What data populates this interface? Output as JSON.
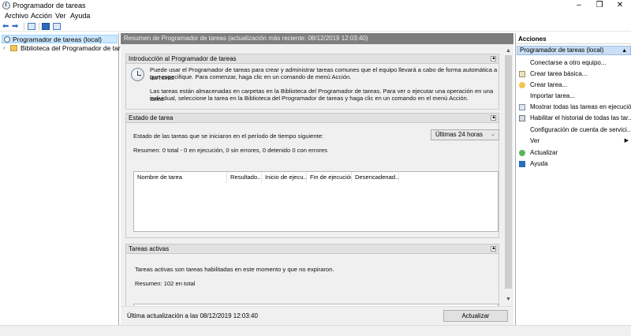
{
  "window": {
    "title": "Programador de tareas",
    "minimize": "–",
    "restore": "❐",
    "close": "✕"
  },
  "menu": [
    "Archivo",
    "Acción",
    "Ver",
    "Ayuda"
  ],
  "toolbar": {
    "back_icon": "arrow-left-icon",
    "forward_icon": "arrow-right-icon",
    "back": "⬅",
    "forward": "➡"
  },
  "tree": {
    "root": "Programador de tareas (local)",
    "child": "Biblioteca del Programador de tareas",
    "expander": "›"
  },
  "center": {
    "header": "Resumen de Programador de tareas (actualización más reciente: 08/12/2019 12:03:40)",
    "intro": {
      "title": "Introducción al Programador de tareas",
      "p1_line1": "Puede usar el Programador de tareas para crear y administrar tareas comunes que el equipo llevará a cabo de forma automática a las horas",
      "p1_line2": "que especifique. Para comenzar, haga clic en un comando de menú Acción.",
      "p2_line1": "Las tareas están almacenadas en carpetas en la Biblioteca del Programador de tareas. Para ver o ejecutar una operación en una tarea",
      "p2_line2": "individual, seleccione la tarea en la Biblioteca del Programador de tareas y haga clic en un comando en el menú Acción."
    },
    "status": {
      "title": "Estado de tarea",
      "period_label": "Estado de las tareas que se iniciaron en el período de tiempo siguiente:",
      "period_value": "Últimas 24 horas",
      "summary": "Resumen: 0 total - 0 en ejecución, 0 sin errores, 0 detenido  0 con errores",
      "columns": [
        "Nombre de tarea",
        "Resultado...",
        "Inicio de ejecu...",
        "Fin de ejecución",
        "Desencadenad..."
      ]
    },
    "active": {
      "title": "Tareas activas",
      "description": "Tareas activas son tareas habilitadas en este momento y que no expiraron.",
      "summary": "Resumen: 102 en total"
    },
    "footer": {
      "last_update": "Última actualización a las 08/12/2019 12:03:40",
      "refresh_button": "Actualizar"
    },
    "collapse_glyph": "▲",
    "scroll_up": "▲",
    "scroll_down": "▼",
    "dropdown_chevron": "⌄"
  },
  "actions": {
    "heading": "Acciones",
    "group": "Programador de tareas (local)",
    "group_toggle": "▲",
    "submenu_arrow": "▶",
    "items": [
      {
        "label": "Conectarse a otro equipo...",
        "icon": "none"
      },
      {
        "label": "Crear tarea básica...",
        "icon": "create-basic-task-icon"
      },
      {
        "label": "Crear tarea...",
        "icon": "create-task-icon"
      },
      {
        "label": "Importar tarea...",
        "icon": "none"
      },
      {
        "label": "Mostrar todas las tareas en ejecución",
        "icon": "running-tasks-icon"
      },
      {
        "label": "Habilitar el historial de todas las tar...",
        "icon": "history-icon"
      },
      {
        "label": "Configuración de cuenta de servici...",
        "icon": "none"
      },
      {
        "label": "Ver",
        "icon": "none"
      },
      {
        "label": "Actualizar",
        "icon": "refresh-icon"
      },
      {
        "label": "Ayuda",
        "icon": "help-icon"
      }
    ]
  },
  "colors": {
    "selection": "#cde8ff",
    "header_bar": "#7e7e7e",
    "panel_bg": "#f0f0f0",
    "actions_group": "#c9dff5"
  }
}
